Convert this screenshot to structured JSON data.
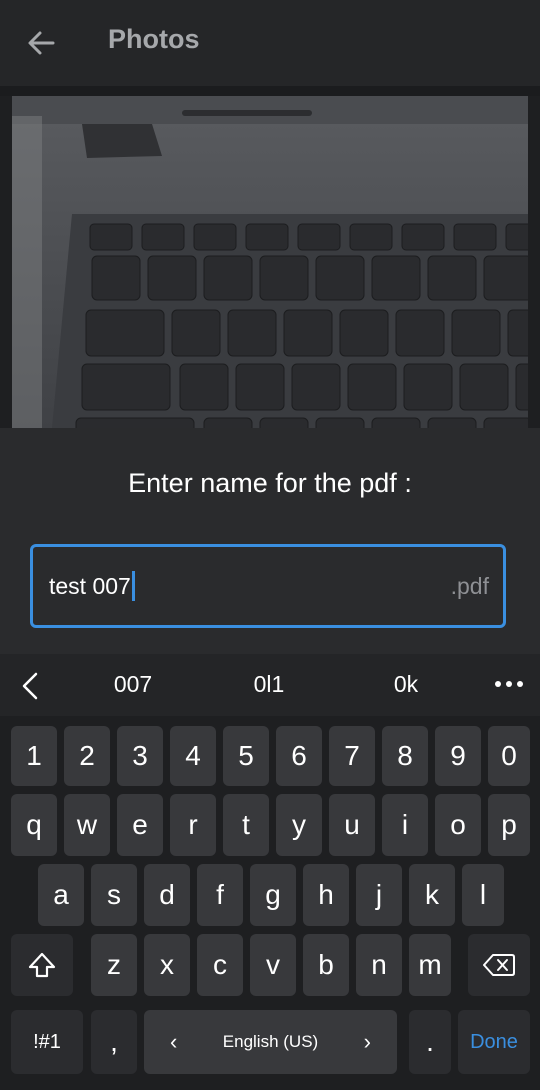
{
  "header": {
    "title": "Photos",
    "back_icon": "arrow-left-icon"
  },
  "dialog": {
    "title": "Enter name for the pdf :",
    "input_value": "test 007",
    "input_suffix": ".pdf",
    "accent_color": "#3a8fe0"
  },
  "suggestions": {
    "items": [
      "007",
      "0l1",
      "0k"
    ],
    "back_icon": "chevron-left-icon",
    "more_icon": "more-horizontal-icon"
  },
  "keyboard": {
    "row_numbers": [
      "1",
      "2",
      "3",
      "4",
      "5",
      "6",
      "7",
      "8",
      "9",
      "0"
    ],
    "row_top": [
      "q",
      "w",
      "e",
      "r",
      "t",
      "y",
      "u",
      "i",
      "o",
      "p"
    ],
    "row_middle": [
      "a",
      "s",
      "d",
      "f",
      "g",
      "h",
      "j",
      "k",
      "l"
    ],
    "row_bottom": [
      "z",
      "x",
      "c",
      "v",
      "b",
      "n",
      "m"
    ],
    "shift_icon": "shift-icon",
    "backspace_icon": "backspace-icon",
    "symbols_label": "!#1",
    "comma_label": ",",
    "language_label": "English (US)",
    "language_prev": "‹",
    "language_next": "›",
    "period_label": ".",
    "done_label": "Done",
    "done_color": "#3a8fe0"
  }
}
